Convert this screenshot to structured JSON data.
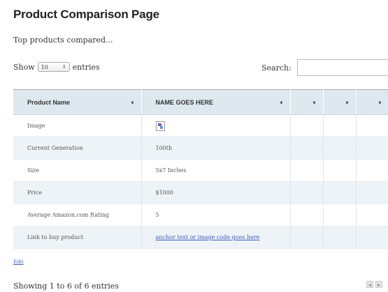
{
  "page": {
    "title": "Product Comparison Page",
    "subtitle": "Top products compared..."
  },
  "controls": {
    "show_label": "Show",
    "length_value": "10",
    "entries_label": "entries",
    "search_label": "Search:",
    "search_value": ""
  },
  "table": {
    "columns": [
      "Product Name",
      "NAME GOES HERE",
      "",
      "",
      "",
      ""
    ],
    "rows": [
      {
        "label": "Image",
        "value": "",
        "value_type": "image"
      },
      {
        "label": "Current Generation",
        "value": "100th"
      },
      {
        "label": "Size",
        "value": "5x7 Inches"
      },
      {
        "label": "Price",
        "value": "$1000"
      },
      {
        "label": "Average Amazon.com Rating",
        "value": "5"
      },
      {
        "label": "Link to buy product",
        "value": "anchor text or image code goes here",
        "value_type": "link"
      }
    ]
  },
  "footer": {
    "edit_label": "Edit",
    "info": "Showing 1 to 6 of 6 entries"
  },
  "icons": {
    "sort": "sort-icon",
    "select_arrows": "select-arrows-icon",
    "broken_image": "broken-image-icon",
    "prev": "previous-page-icon",
    "next": "next-page-icon"
  },
  "colors": {
    "header_bg": "#dde8ef",
    "stripe_bg": "#eef3f7",
    "link": "#3b5fbf"
  }
}
